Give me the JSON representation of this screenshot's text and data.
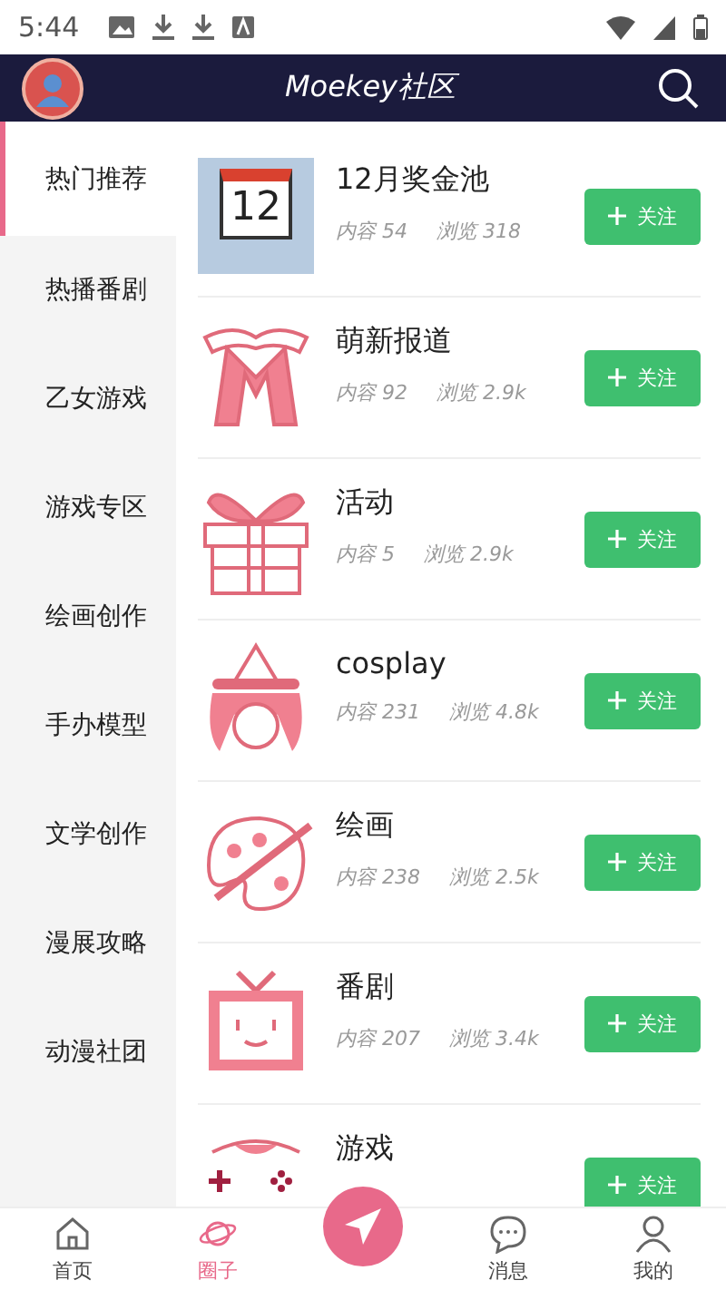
{
  "status_bar": {
    "time": "5:44"
  },
  "header": {
    "title": "Moekey社区"
  },
  "sidebar": {
    "items": [
      {
        "label": "热门推荐",
        "selected": true
      },
      {
        "label": "热播番剧",
        "selected": false
      },
      {
        "label": "乙女游戏",
        "selected": false
      },
      {
        "label": "游戏专区",
        "selected": false
      },
      {
        "label": "绘画创作",
        "selected": false
      },
      {
        "label": "手办模型",
        "selected": false
      },
      {
        "label": "文学创作",
        "selected": false
      },
      {
        "label": "漫展攻略",
        "selected": false
      },
      {
        "label": "动漫社团",
        "selected": false
      }
    ]
  },
  "groups": [
    {
      "kind": "calendar",
      "icon_label": "12",
      "name": "12月奖金池",
      "content": "内容 54",
      "views": "浏览 318",
      "follow": "关注"
    },
    {
      "kind": "ribbon",
      "name": "萌新报道",
      "content": "内容 92",
      "views": "浏览 2.9k",
      "follow": "关注"
    },
    {
      "kind": "gift",
      "name": "活动",
      "content": "内容 5",
      "views": "浏览 2.9k",
      "follow": "关注"
    },
    {
      "kind": "witch",
      "name": "cosplay",
      "content": "内容 231",
      "views": "浏览 4.8k",
      "follow": "关注"
    },
    {
      "kind": "palette",
      "name": "绘画",
      "content": "内容 238",
      "views": "浏览 2.5k",
      "follow": "关注"
    },
    {
      "kind": "tv",
      "name": "番剧",
      "content": "内容 207",
      "views": "浏览 3.4k",
      "follow": "关注"
    },
    {
      "kind": "gamepad",
      "name": "游戏",
      "follow": "关注"
    }
  ],
  "bottom_nav": [
    {
      "kind": "home",
      "label": "首页",
      "selected": false
    },
    {
      "kind": "planet",
      "label": "圈子",
      "selected": true
    },
    {
      "kind": "post"
    },
    {
      "kind": "chat",
      "label": "消息",
      "selected": false
    },
    {
      "kind": "person",
      "label": "我的",
      "selected": false
    }
  ]
}
